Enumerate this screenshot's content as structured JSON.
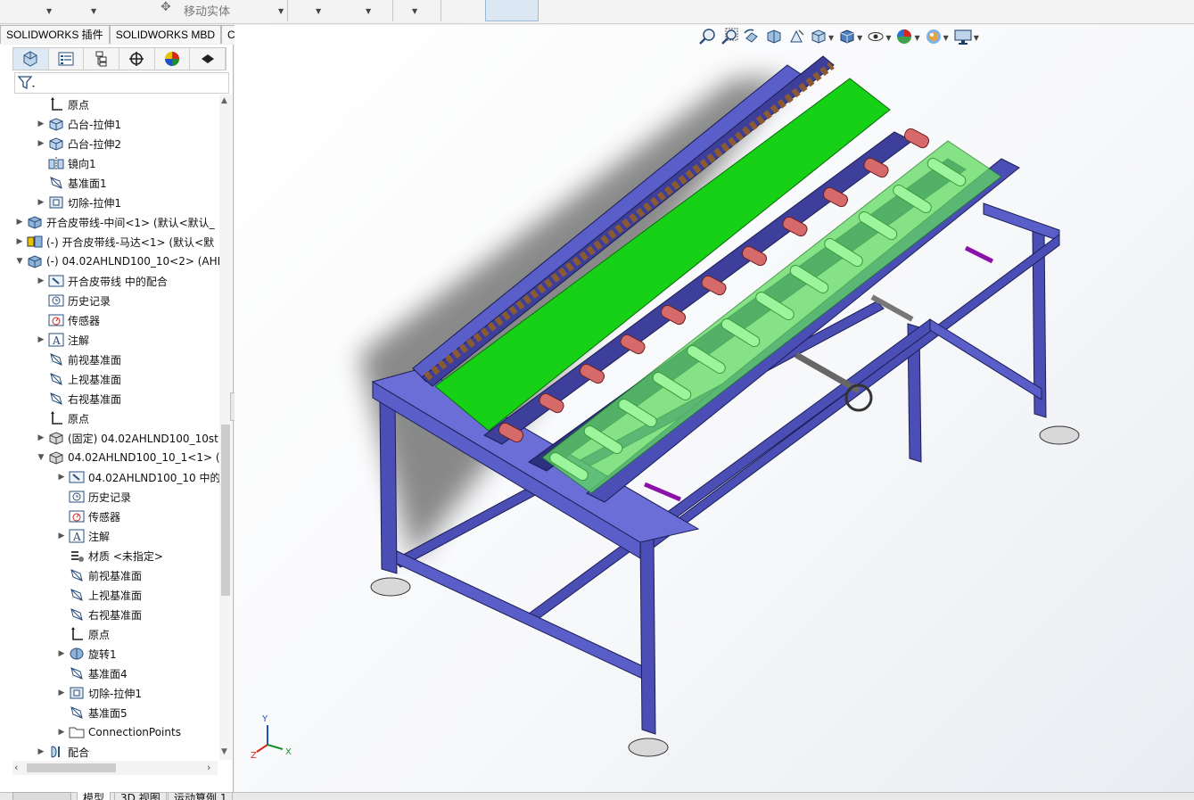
{
  "ribbon": {
    "move_body_label": "移动实体",
    "move_body_icon": "move-body-icon"
  },
  "tabs": [
    {
      "label": "SOLIDWORKS 插件"
    },
    {
      "label": "SOLIDWORKS MBD"
    },
    {
      "label": "CircuitWorks"
    }
  ],
  "panel_tabs": [
    {
      "icon": "feature-manager-icon"
    },
    {
      "icon": "property-manager-icon"
    },
    {
      "icon": "configuration-manager-icon"
    },
    {
      "icon": "dimxpert-icon"
    },
    {
      "icon": "display-manager-icon"
    },
    {
      "icon": "cam-icon"
    }
  ],
  "filter_icon": "filter-icon",
  "tree": [
    {
      "indent": 2,
      "arrow": "",
      "icon": "origin-icon",
      "label": "原点"
    },
    {
      "indent": 2,
      "arrow": "▶",
      "icon": "boss-extrude-icon",
      "label": "凸台-拉伸1"
    },
    {
      "indent": 2,
      "arrow": "▶",
      "icon": "boss-extrude-icon",
      "label": "凸台-拉伸2"
    },
    {
      "indent": 2,
      "arrow": "",
      "icon": "mirror-icon",
      "label": "镜向1"
    },
    {
      "indent": 2,
      "arrow": "",
      "icon": "plane-icon",
      "label": "基准面1"
    },
    {
      "indent": 2,
      "arrow": "▶",
      "icon": "cut-extrude-icon",
      "label": "切除-拉伸1"
    },
    {
      "indent": 1,
      "arrow": "▶",
      "icon": "part-icon",
      "label": "开合皮带线-中间<1> (默认<默认_"
    },
    {
      "indent": 1,
      "arrow": "▶",
      "icon": "subassembly-icon",
      "label": "(-) 开合皮带线-马达<1> (默认<默"
    },
    {
      "indent": 1,
      "arrow": "▼",
      "icon": "part-icon",
      "label": "(-) 04.02AHLND100_10<2> (AHI"
    },
    {
      "indent": 2,
      "arrow": "▶",
      "icon": "mates-folder-icon",
      "label": "开合皮带线 中的配合"
    },
    {
      "indent": 2,
      "arrow": "",
      "icon": "history-icon",
      "label": "历史记录"
    },
    {
      "indent": 2,
      "arrow": "",
      "icon": "sensor-icon",
      "label": "传感器"
    },
    {
      "indent": 2,
      "arrow": "▶",
      "icon": "annotation-icon",
      "label": "注解"
    },
    {
      "indent": 2,
      "arrow": "",
      "icon": "plane-icon",
      "label": "前视基准面"
    },
    {
      "indent": 2,
      "arrow": "",
      "icon": "plane-icon",
      "label": "上视基准面"
    },
    {
      "indent": 2,
      "arrow": "",
      "icon": "plane-icon",
      "label": "右视基准面"
    },
    {
      "indent": 2,
      "arrow": "",
      "icon": "origin-icon",
      "label": "原点"
    },
    {
      "indent": 2,
      "arrow": "▶",
      "icon": "fixed-part-icon",
      "label": "(固定) 04.02AHLND100_10st"
    },
    {
      "indent": 2,
      "arrow": "▼",
      "icon": "fixed-part-icon",
      "label": "04.02AHLND100_10_1<1> ("
    },
    {
      "indent": 3,
      "arrow": "▶",
      "icon": "mates-folder-icon",
      "label": "04.02AHLND100_10 中的"
    },
    {
      "indent": 3,
      "arrow": "",
      "icon": "history-icon",
      "label": "历史记录"
    },
    {
      "indent": 3,
      "arrow": "",
      "icon": "sensor-icon",
      "label": "传感器"
    },
    {
      "indent": 3,
      "arrow": "▶",
      "icon": "annotation-icon",
      "label": "注解"
    },
    {
      "indent": 3,
      "arrow": "",
      "icon": "material-icon",
      "label": "材质 <未指定>"
    },
    {
      "indent": 3,
      "arrow": "",
      "icon": "plane-icon",
      "label": "前视基准面"
    },
    {
      "indent": 3,
      "arrow": "",
      "icon": "plane-icon",
      "label": "上视基准面"
    },
    {
      "indent": 3,
      "arrow": "",
      "icon": "plane-icon",
      "label": "右视基准面"
    },
    {
      "indent": 3,
      "arrow": "",
      "icon": "origin-icon",
      "label": "原点"
    },
    {
      "indent": 3,
      "arrow": "▶",
      "icon": "revolve-icon",
      "label": "旋转1"
    },
    {
      "indent": 3,
      "arrow": "",
      "icon": "plane-icon",
      "label": "基准面4"
    },
    {
      "indent": 3,
      "arrow": "▶",
      "icon": "cut-extrude-icon",
      "label": "切除-拉伸1"
    },
    {
      "indent": 3,
      "arrow": "",
      "icon": "plane-icon",
      "label": "基准面5"
    },
    {
      "indent": 3,
      "arrow": "▶",
      "icon": "folder-icon",
      "label": "ConnectionPoints"
    },
    {
      "indent": 2,
      "arrow": "▶",
      "icon": "mates-icon",
      "label": "配合"
    }
  ],
  "bottom_tabs": [
    {
      "label": "模型"
    },
    {
      "label": "3D 视图"
    },
    {
      "label": "运动算例 1"
    }
  ],
  "hud_icons": [
    "zoom-to-fit-icon",
    "zoom-to-area-icon",
    "previous-view-icon",
    "section-view-icon",
    "dynamic-annotation-icon",
    "view-orientation-icon",
    "display-style-icon",
    "hide-show-icon",
    "edit-appearance-icon",
    "apply-scene-icon",
    "view-settings-icon"
  ],
  "axis_labels": {
    "x": "X",
    "y": "Y",
    "z": "Z"
  },
  "colors": {
    "frame": "#4b4fb5",
    "belt_green": "#16d116",
    "roller_green": "#9cf59c",
    "roller_red": "#d66a6a",
    "purple_bar": "#8b12a8"
  }
}
